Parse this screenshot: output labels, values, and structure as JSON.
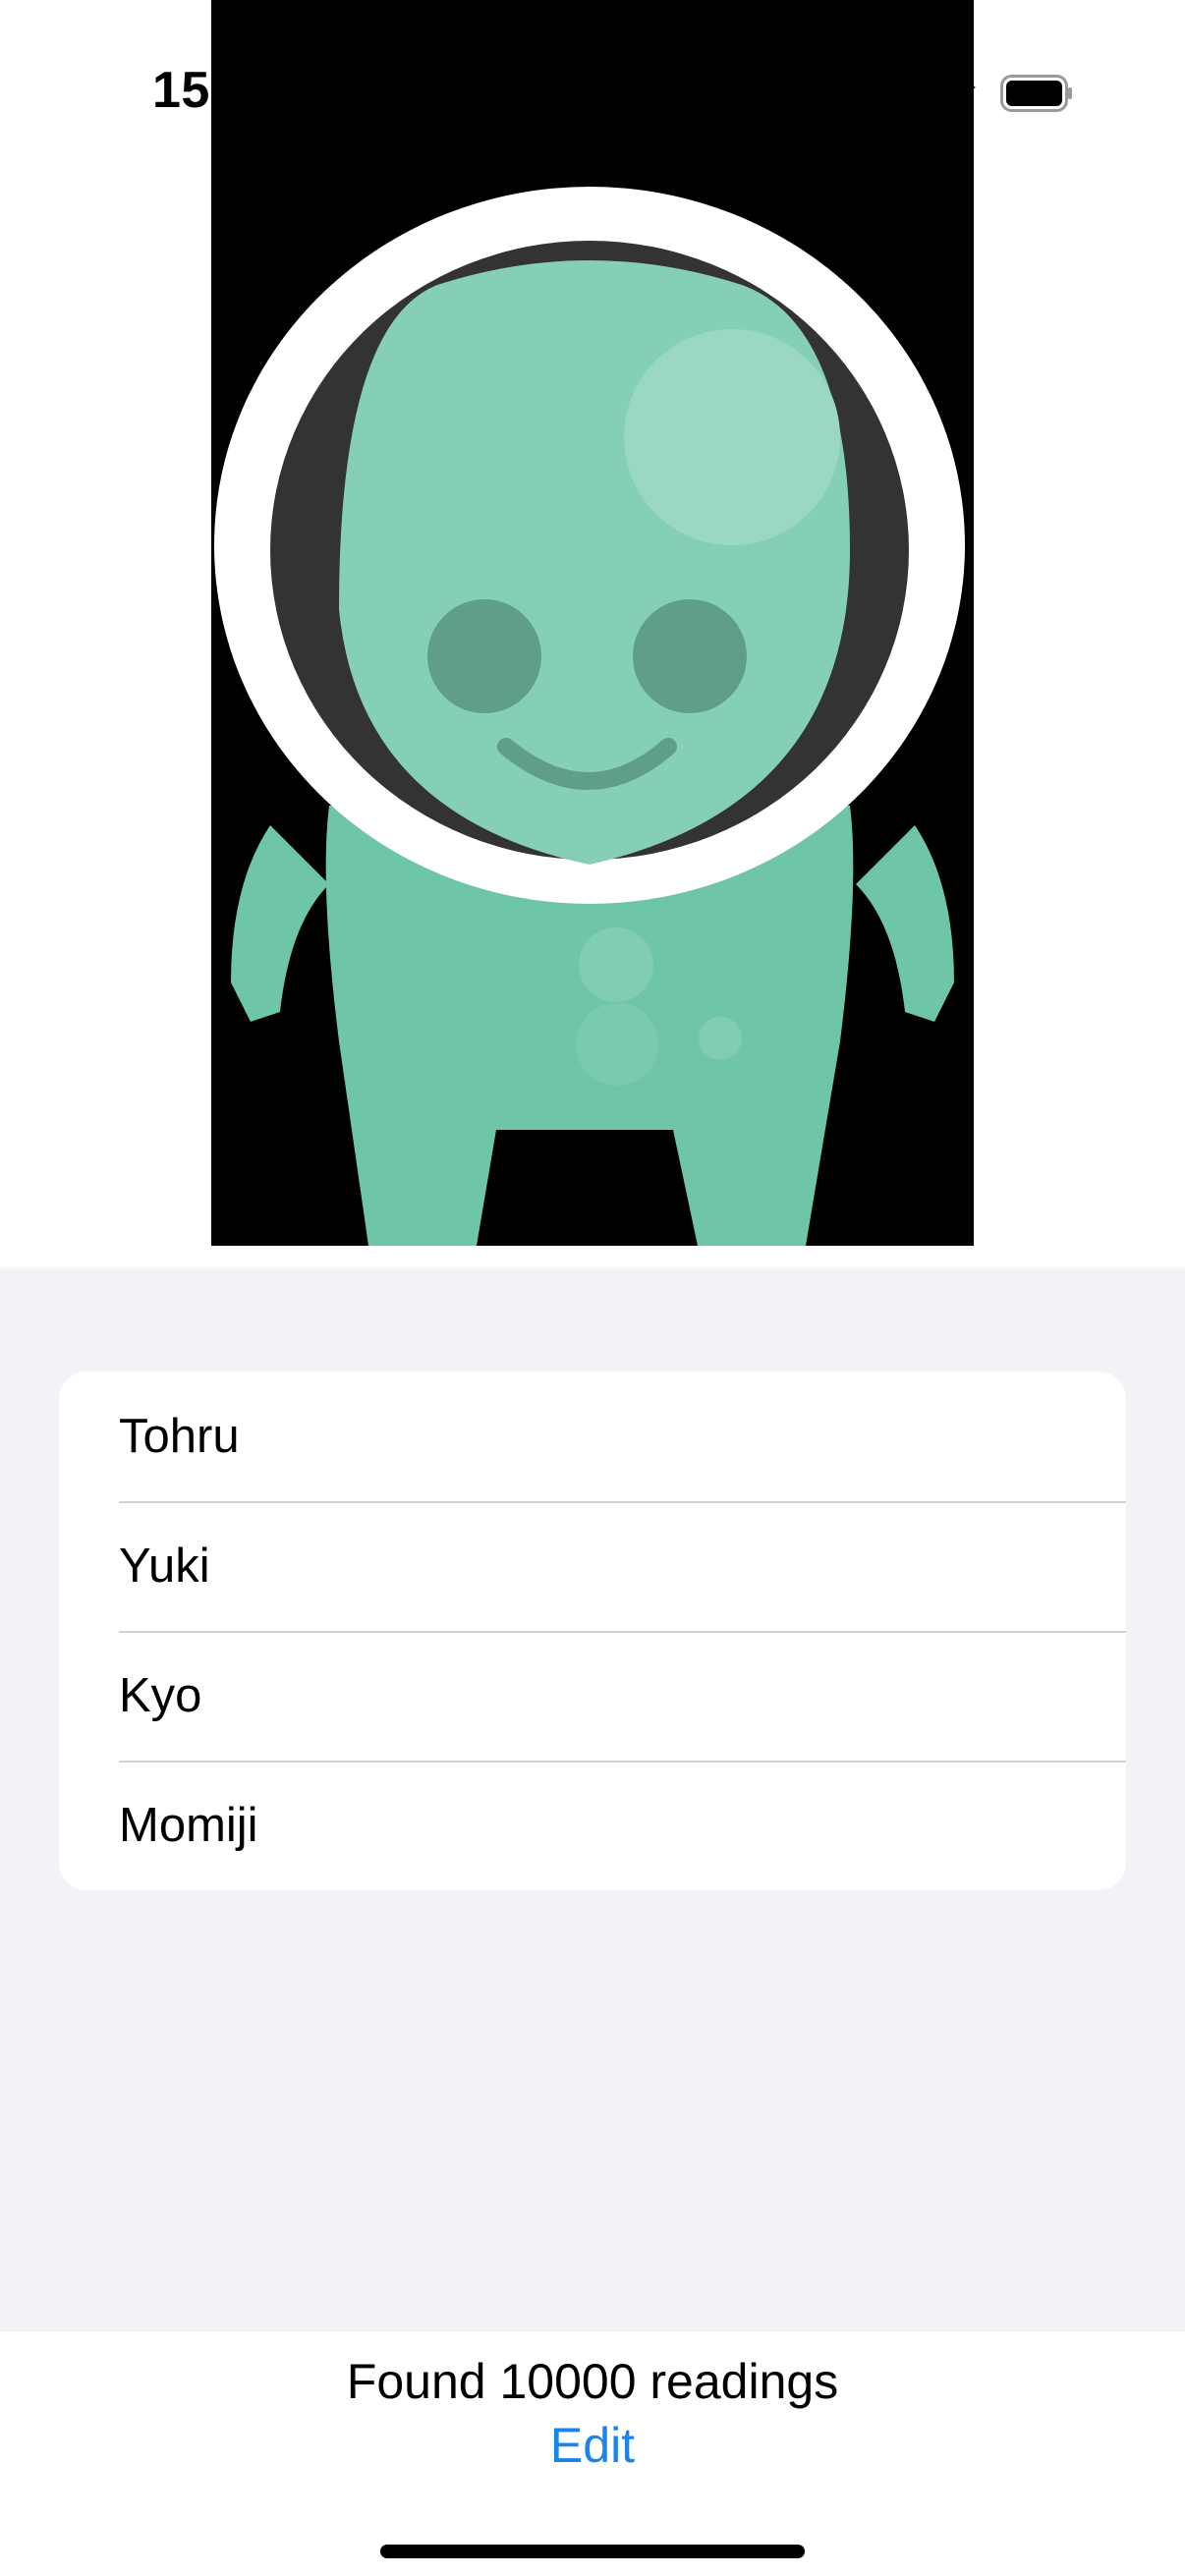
{
  "status_bar": {
    "time": "15",
    "battery_icon": "battery-full-icon"
  },
  "hero": {
    "image_description_icon": "alien-mascot-icon",
    "colors": {
      "background": "#000000",
      "body": "#6fc5a9",
      "helmet_ring": "#ffffff",
      "helmet_inner": "#333333",
      "face": "#85cfb6",
      "eyes": "#5f9f8a"
    }
  },
  "list": {
    "items": [
      {
        "label": "Tohru"
      },
      {
        "label": "Yuki"
      },
      {
        "label": "Kyo"
      },
      {
        "label": "Momiji"
      }
    ]
  },
  "footer": {
    "status_text": "Found 10000 readings",
    "edit_label": "Edit",
    "accent_color": "#1a84ea"
  }
}
